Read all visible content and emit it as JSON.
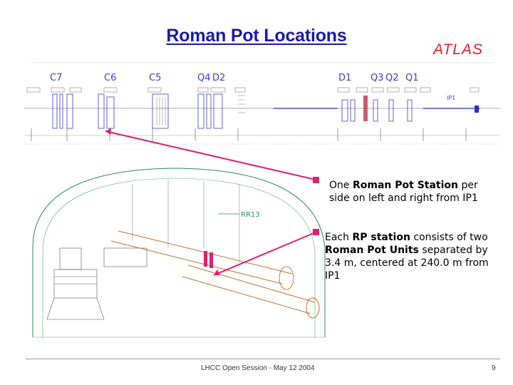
{
  "slide": {
    "title": "Roman Pot Locations",
    "logo_text": "ATLAS",
    "footer_left": "LHCC Open Session - May 12 2004",
    "page_number": "9"
  },
  "notes": {
    "note1": {
      "t1": "One ",
      "b1": "Roman Pot Station",
      "t2": " per side on left and right from IP1"
    },
    "note2": {
      "t1": "Each ",
      "b1": "RP station",
      "t2": " consists of two ",
      "b2": "Roman Pot Units",
      "t3": " separated by 3.4 m, centered at 240.0 m from IP1"
    }
  },
  "beamline": {
    "element_labels": [
      "C7",
      "C6",
      "C5",
      "Q4",
      "D2",
      "D1",
      "Q3",
      "Q2",
      "Q1"
    ],
    "ip_label": "IP1",
    "tunnel_label": "RR13"
  },
  "colors": {
    "title": "#1a1aa6",
    "logo": "#e0202a",
    "arrow": "#e0206e",
    "beam": "#2b2bd0"
  }
}
